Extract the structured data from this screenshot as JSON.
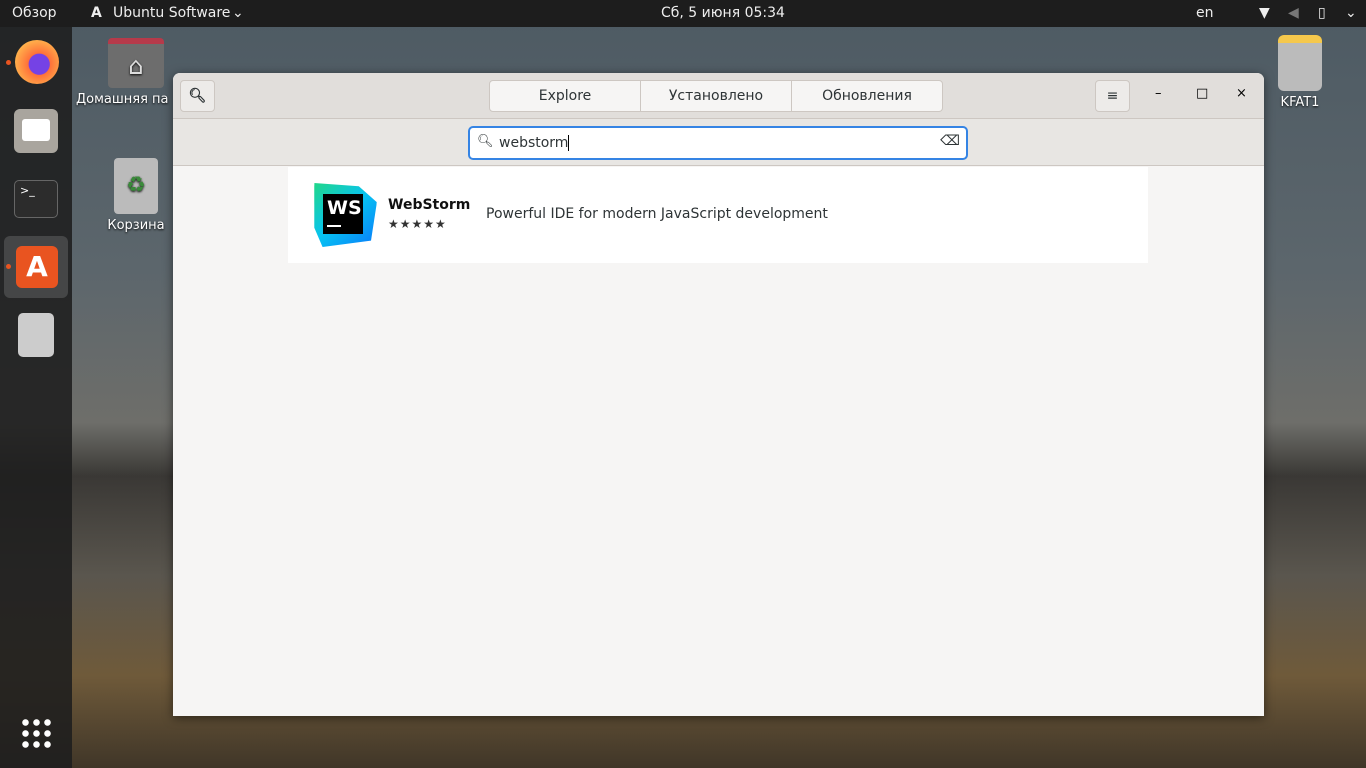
{
  "topbar": {
    "activities": "Обзор",
    "app_menu": "Ubuntu Software",
    "clock": "Сб, 5 июня  05:34",
    "keyboard": "en"
  },
  "desktop": {
    "home": "Домашняя па",
    "trash": "Корзина",
    "drive": "KFAT1"
  },
  "window": {
    "tabs": [
      "Explore",
      "Установлено",
      "Обновления"
    ],
    "search_value": "webstorm",
    "results": [
      {
        "name": "WebStorm",
        "rating": 5,
        "stars": "★★★★★",
        "summary": "Powerful IDE for modern JavaScript development"
      }
    ]
  }
}
